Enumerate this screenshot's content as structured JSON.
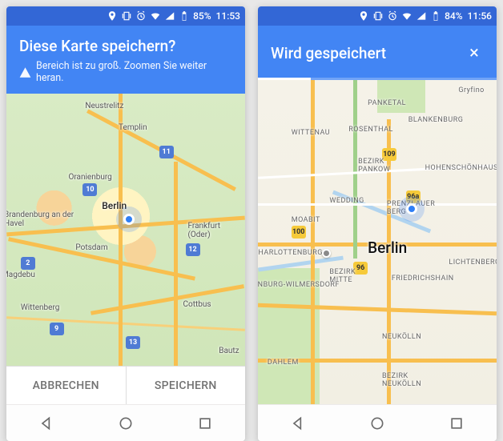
{
  "left": {
    "statusBar": {
      "battery": "85%",
      "time": "11:53"
    },
    "header": {
      "title": "Diese Karte speichern?",
      "warning": "Bereich ist zu groß. Zoomen Sie weiter heran."
    },
    "map": {
      "labels": {
        "neustrelitz": "Neustrelitz",
        "templin": "Templin",
        "oranienburg": "Oranienburg",
        "brandenburg": "Brandenburg an der Havel",
        "berlin": "Berlin",
        "potsdam": "Potsdam",
        "frankfurtOder": "Frankfurt (Oder)",
        "wittenberg": "Wittenberg",
        "magdebu": "Magdebu",
        "cottbus": "Cottbus",
        "bautz": "Bautz"
      },
      "shields": {
        "a11": "11",
        "a10": "10",
        "a2": "2",
        "a12": "12",
        "a13": "13",
        "a9": "9"
      }
    },
    "footer": {
      "cancel": "ABBRECHEN",
      "save": "SPEICHERN"
    }
  },
  "right": {
    "statusBar": {
      "battery": "84%",
      "time": "11:56"
    },
    "header": {
      "title": "Wird gespeichert"
    },
    "map": {
      "labels": {
        "berlin": "Berlin",
        "gryfino": "Gryfino",
        "panketal": "PANKETAL",
        "blankenburg": "BLANKENBURG",
        "wittenau": "WITTENAU",
        "rosenthal": "ROSENTHAL",
        "bezirkPankow": "BEZIRK PANKOW",
        "prenzlauerBerg": "PRENZLAUER BERG",
        "wedding": "WEDDING",
        "moabit": "MOABIT",
        "charlottenburg": "CHARLOTTENBURG",
        "bezirkMitte": "BEZIRK MITTE",
        "enburgWilmersdorf": "ENBURG-WILMERSDORF",
        "friedrichshain": "FRIEDRICHSHAIN",
        "dahlem": "DAHLEM",
        "hohenschonhausen": "HOHENSCHÖNHAUSEN",
        "lichtenberg": "LICHTENBERG",
        "neukolln": "NEUKÖLLN",
        "bezirkNeukolln": "BEZIRK NEUKÖLLN"
      },
      "shields": {
        "b100": "100",
        "b96a": "96a",
        "b96": "96",
        "b109": "109"
      }
    }
  }
}
